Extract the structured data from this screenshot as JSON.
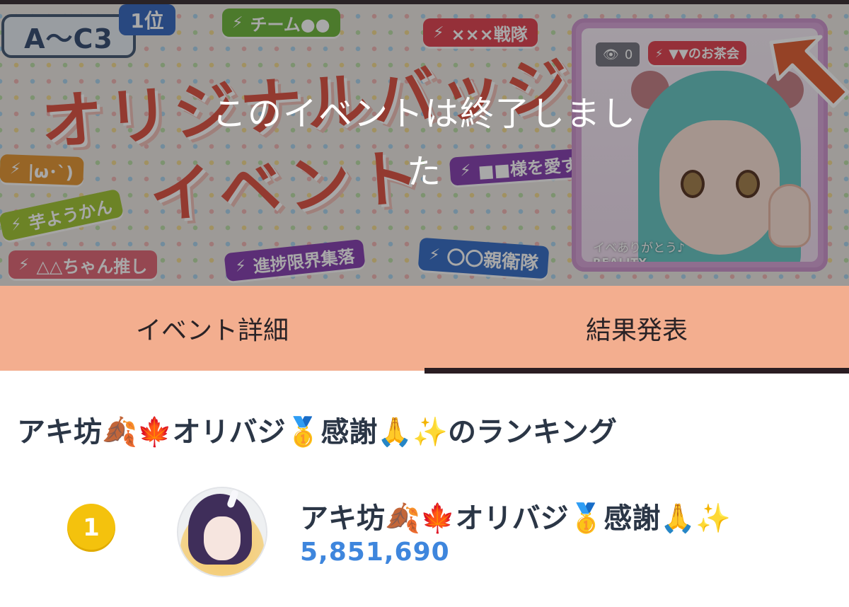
{
  "banner": {
    "grade_tag": "A～C3",
    "rank_tag": "1位",
    "title_line1": "オリジナルバッジ",
    "title_line2": "イベント",
    "ended_message": "このイベントは終了しました",
    "badges": [
      {
        "label": "チーム●●",
        "color": "#74b944"
      },
      {
        "label": "×××戦隊",
        "color": "#e24a57"
      },
      {
        "label": "|ω･`)",
        "color": "#e59a3b"
      },
      {
        "label": "芋ようかん",
        "color": "#a4c73b"
      },
      {
        "label": "△△ちゃん推し",
        "color": "#e36d7b"
      },
      {
        "label": "進捗限界集落",
        "color": "#8a47b3"
      },
      {
        "label": "■■様を愛す",
        "color": "#8a47b3"
      },
      {
        "label": "〇〇親衛隊",
        "color": "#3d73c8"
      }
    ],
    "preview": {
      "viewer_count": "0",
      "badge_label": "▼▼のお茶会",
      "badge_color": "#e24a57",
      "comment": "イベありがとう♪",
      "brand": "REALITY"
    }
  },
  "tabs": [
    {
      "label": "イベント詳細",
      "active": false
    },
    {
      "label": "結果発表",
      "active": true
    }
  ],
  "ranking": {
    "heading": "アキ坊🍂🍁オリバジ🥇感謝🙏✨のランキング",
    "entries": [
      {
        "rank": "1",
        "name": "アキ坊🍂🍁オリバジ🥇感謝🙏✨",
        "score": "5,851,690"
      }
    ]
  },
  "colors": {
    "tab_bg": "#f3ae8f",
    "score": "#3e86dd",
    "medal_gold": "#f4c20d"
  }
}
